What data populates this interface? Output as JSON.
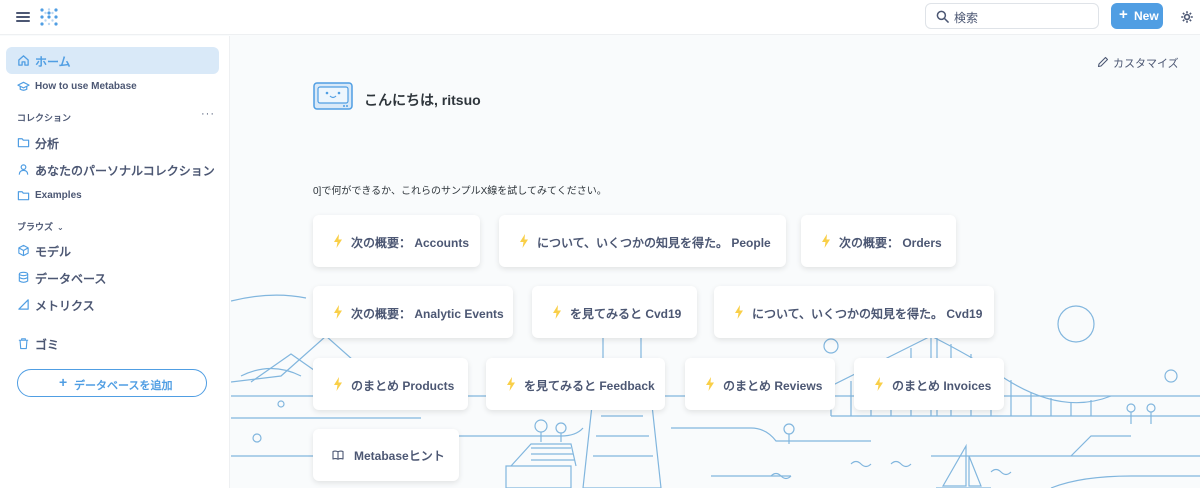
{
  "topbar": {
    "search_placeholder": "検索",
    "new_label": "New"
  },
  "sidebar": {
    "home_label": "ホーム",
    "how_to_label": "How to use Metabase",
    "collections_header": "コレクション",
    "collections_menu": "···",
    "collections": [
      {
        "label": "分析",
        "icon": "folder-icon"
      },
      {
        "label": "あなたのパーソナルコレクション",
        "icon": "person-icon"
      },
      {
        "label": "Examples",
        "icon": "folder-icon"
      }
    ],
    "browse_header": "ブラウズ",
    "browse_chevron": "⌄",
    "browse": [
      {
        "label": "モデル",
        "icon": "model-cube-icon"
      },
      {
        "label": "データベース",
        "icon": "database-icon"
      },
      {
        "label": "メトリクス",
        "icon": "metric-icon"
      }
    ],
    "trash_label": "ゴミ",
    "add_database_label": "データベースを追加"
  },
  "main": {
    "customize_label": "カスタマイズ",
    "greeting": "こんにちは, ritsuo",
    "intro": "0]で何ができるか、これらのサンプルX線を試してみてください。",
    "cards": [
      {
        "label": "次の概要： Accounts"
      },
      {
        "label": "について、いくつかの知見を得た。 People"
      },
      {
        "label": "次の概要： Orders"
      },
      {
        "label": "次の概要： Analytic Events"
      },
      {
        "label": "を見てみると Cvd19"
      },
      {
        "label": "について、いくつかの知見を得た。 Cvd19"
      },
      {
        "label": "のまとめ Products"
      },
      {
        "label": "を見てみると Feedback"
      },
      {
        "label": "のまとめ Reviews"
      },
      {
        "label": "のまとめ Invoices"
      }
    ],
    "tips_label": "Metabaseヒント"
  },
  "colors": {
    "brand": "#509ee3",
    "active_bg": "#d9e9f8",
    "bolt": "#f9cf48",
    "text": "#4c5773",
    "illustration_line": "#5a9fd4"
  }
}
